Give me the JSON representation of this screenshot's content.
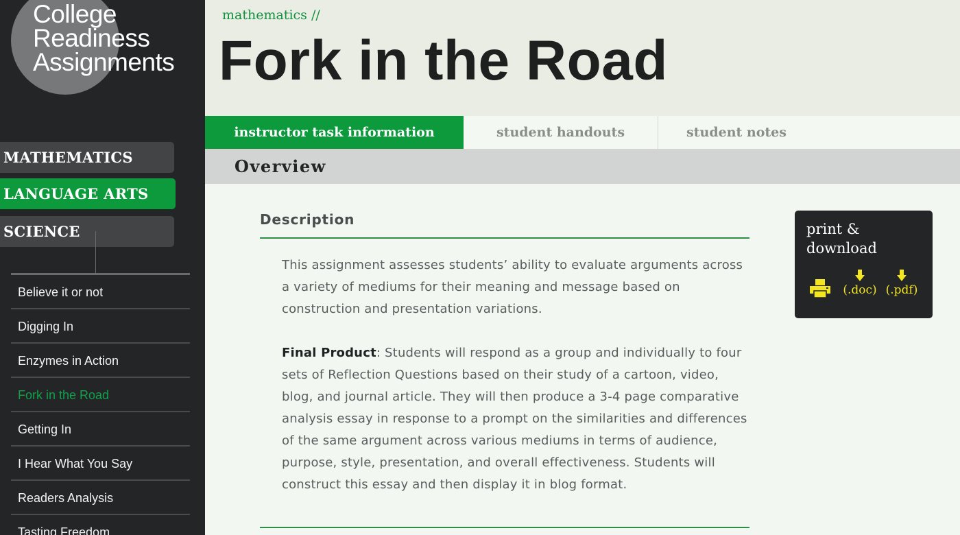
{
  "brand": {
    "logo_lines": [
      "College",
      "Readiness",
      "Assignments"
    ]
  },
  "subjects": [
    {
      "label": "MATHEMATICS"
    },
    {
      "label": "LANGUAGE ARTS"
    },
    {
      "label": "SCIENCE"
    }
  ],
  "assignments": [
    {
      "label": "Believe it or not"
    },
    {
      "label": "Digging In"
    },
    {
      "label": "Enzymes in Action"
    },
    {
      "label": "Fork in the Road"
    },
    {
      "label": "Getting In"
    },
    {
      "label": "I Hear What You Say"
    },
    {
      "label": "Readers Analysis"
    },
    {
      "label": "Tasting Freedom"
    }
  ],
  "header": {
    "breadcrumb": "mathematics //",
    "title": "Fork in the Road"
  },
  "tabs": [
    {
      "label": "instructor task information"
    },
    {
      "label": "student handouts"
    },
    {
      "label": "student notes"
    }
  ],
  "overview": {
    "heading": "Overview"
  },
  "description": {
    "heading": "Description",
    "paragraph": "This assignment assesses students’ ability to evaluate arguments across a variety of mediums for their meaning and message based on construction and presentation variations.",
    "final_product_label": "Final Product",
    "final_product_text": ": Students will respond as a group and individually to four sets of Reflection Questions based on their study of a cartoon, video, blog, and journal article. They will then produce a 3-4 page comparative analysis essay in response to a prompt on the similarities and differences of the same argument across various mediums in terms of audience, purpose, style, presentation, and overall effectiveness. Students will construct this essay and then display it in blog format."
  },
  "download": {
    "title": "print & download",
    "print_icon": "printer-icon",
    "doc_label": "(.doc)",
    "pdf_label": "(.pdf)"
  },
  "colors": {
    "accent_green": "#0c9a3d",
    "sidebar_bg": "#232526",
    "download_yellow": "#f3e51f"
  }
}
